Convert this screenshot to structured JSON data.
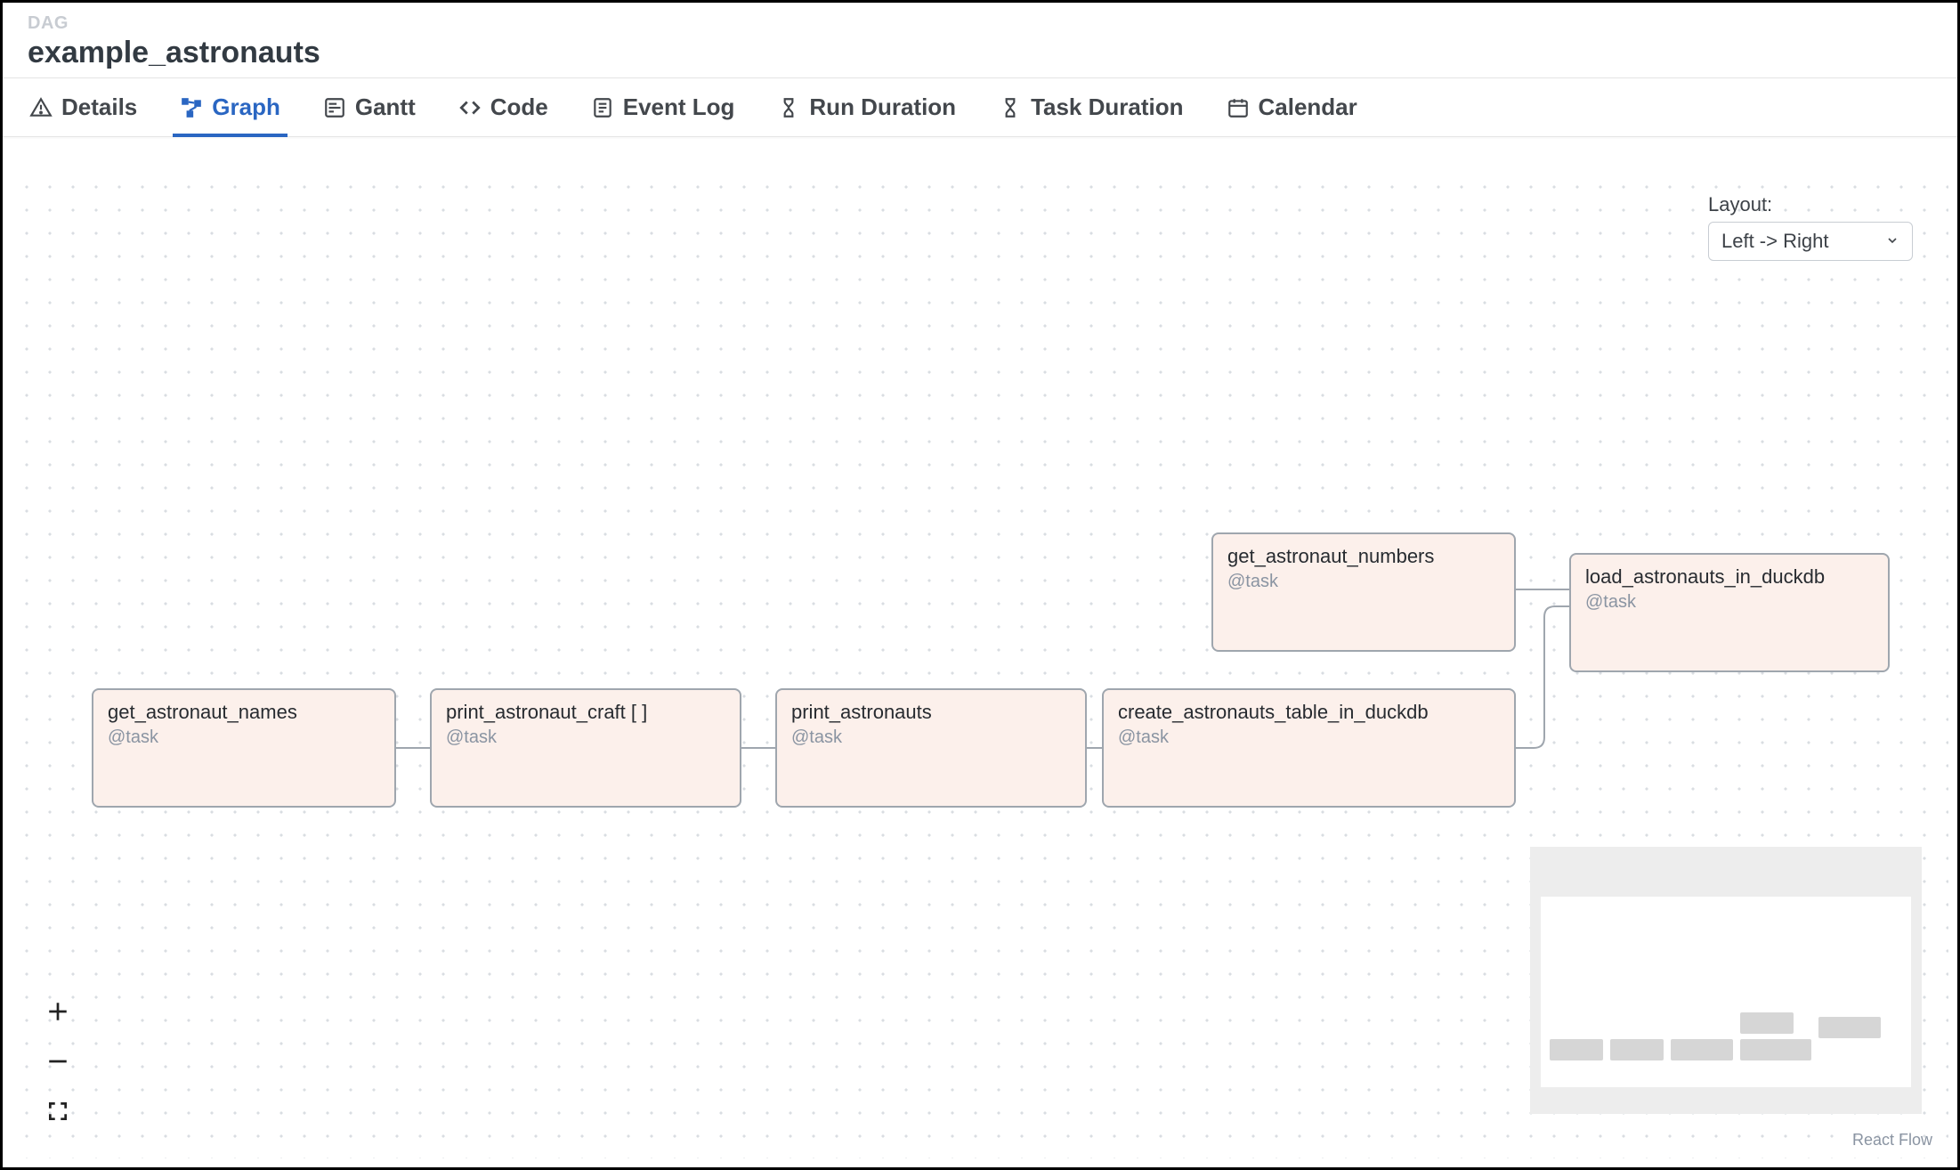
{
  "header": {
    "kicker": "DAG",
    "title": "example_astronauts"
  },
  "tabs": [
    {
      "id": "details",
      "label": "Details"
    },
    {
      "id": "graph",
      "label": "Graph"
    },
    {
      "id": "gantt",
      "label": "Gantt"
    },
    {
      "id": "code",
      "label": "Code"
    },
    {
      "id": "eventlog",
      "label": "Event Log"
    },
    {
      "id": "runduration",
      "label": "Run Duration"
    },
    {
      "id": "taskduration",
      "label": "Task Duration"
    },
    {
      "id": "calendar",
      "label": "Calendar"
    }
  ],
  "active_tab": "graph",
  "layout_control": {
    "label": "Layout:",
    "selected": "Left -> Right"
  },
  "nodes": {
    "get_astronaut_names": {
      "name": "get_astronaut_names",
      "operator": "@task"
    },
    "print_astronaut_craft": {
      "name": "print_astronaut_craft [ ]",
      "operator": "@task"
    },
    "print_astronauts": {
      "name": "print_astronauts",
      "operator": "@task"
    },
    "create_astronauts_table_in_duckdb": {
      "name": "create_astronauts_table_in_duckdb",
      "operator": "@task"
    },
    "get_astronaut_numbers": {
      "name": "get_astronaut_numbers",
      "operator": "@task"
    },
    "load_astronauts_in_duckdb": {
      "name": "load_astronauts_in_duckdb",
      "operator": "@task"
    }
  },
  "edges": [
    [
      "get_astronaut_names",
      "print_astronaut_craft"
    ],
    [
      "print_astronaut_craft",
      "print_astronauts"
    ],
    [
      "print_astronauts",
      "create_astronauts_table_in_duckdb"
    ],
    [
      "create_astronauts_table_in_duckdb",
      "load_astronauts_in_duckdb"
    ],
    [
      "get_astronaut_numbers",
      "load_astronauts_in_duckdb"
    ]
  ],
  "attribution": "React Flow"
}
